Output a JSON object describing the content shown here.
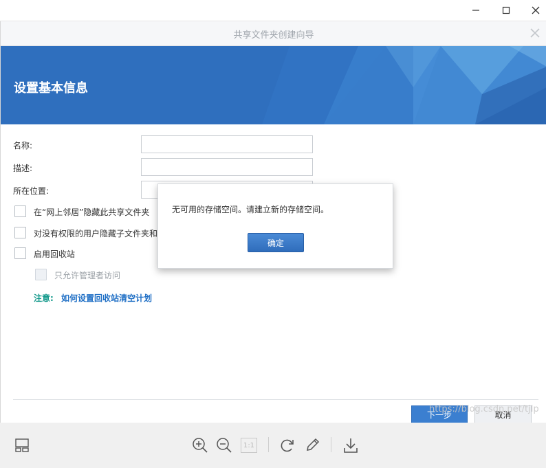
{
  "window": {
    "minimize_icon": "minimize-icon",
    "maximize_icon": "maximize-icon",
    "close_icon": "close-icon"
  },
  "wizard": {
    "title": "共享文件夹创建向导",
    "banner_title": "设置基本信息",
    "fields": [
      {
        "label": "名称:",
        "value": ""
      },
      {
        "label": "描述:",
        "value": ""
      },
      {
        "label": "所在位置:",
        "value": ""
      }
    ],
    "options": [
      {
        "label": "在“网上邻居”隐藏此共享文件夹",
        "checked": false
      },
      {
        "label": "对没有权限的用户隐藏子文件夹和",
        "checked": false
      },
      {
        "label": "启用回收站",
        "checked": false
      },
      {
        "label": "只允许管理者访问",
        "checked": false,
        "disabled": true
      }
    ],
    "note_label": "注意:",
    "note_link": "如何设置回收站清空计划",
    "next_button": "下一步",
    "cancel_button": "取消"
  },
  "dialog": {
    "message": "无可用的存储空间。请建立新的存储空间。",
    "ok_button": "确定"
  },
  "viewer_toolbar": {
    "icons": [
      "layout-icon",
      "zoom-in-icon",
      "zoom-out-icon",
      "actual-size-icon",
      "rotate-icon",
      "edit-icon",
      "download-icon"
    ],
    "actual_size_label": "1:1"
  },
  "watermark": "https://blog.csdn.net/tjlp",
  "colors": {
    "banner": "#2f71c0",
    "primary_button": "#3b7fd0",
    "note_label": "#159a8c",
    "link": "#1f6fc5"
  }
}
